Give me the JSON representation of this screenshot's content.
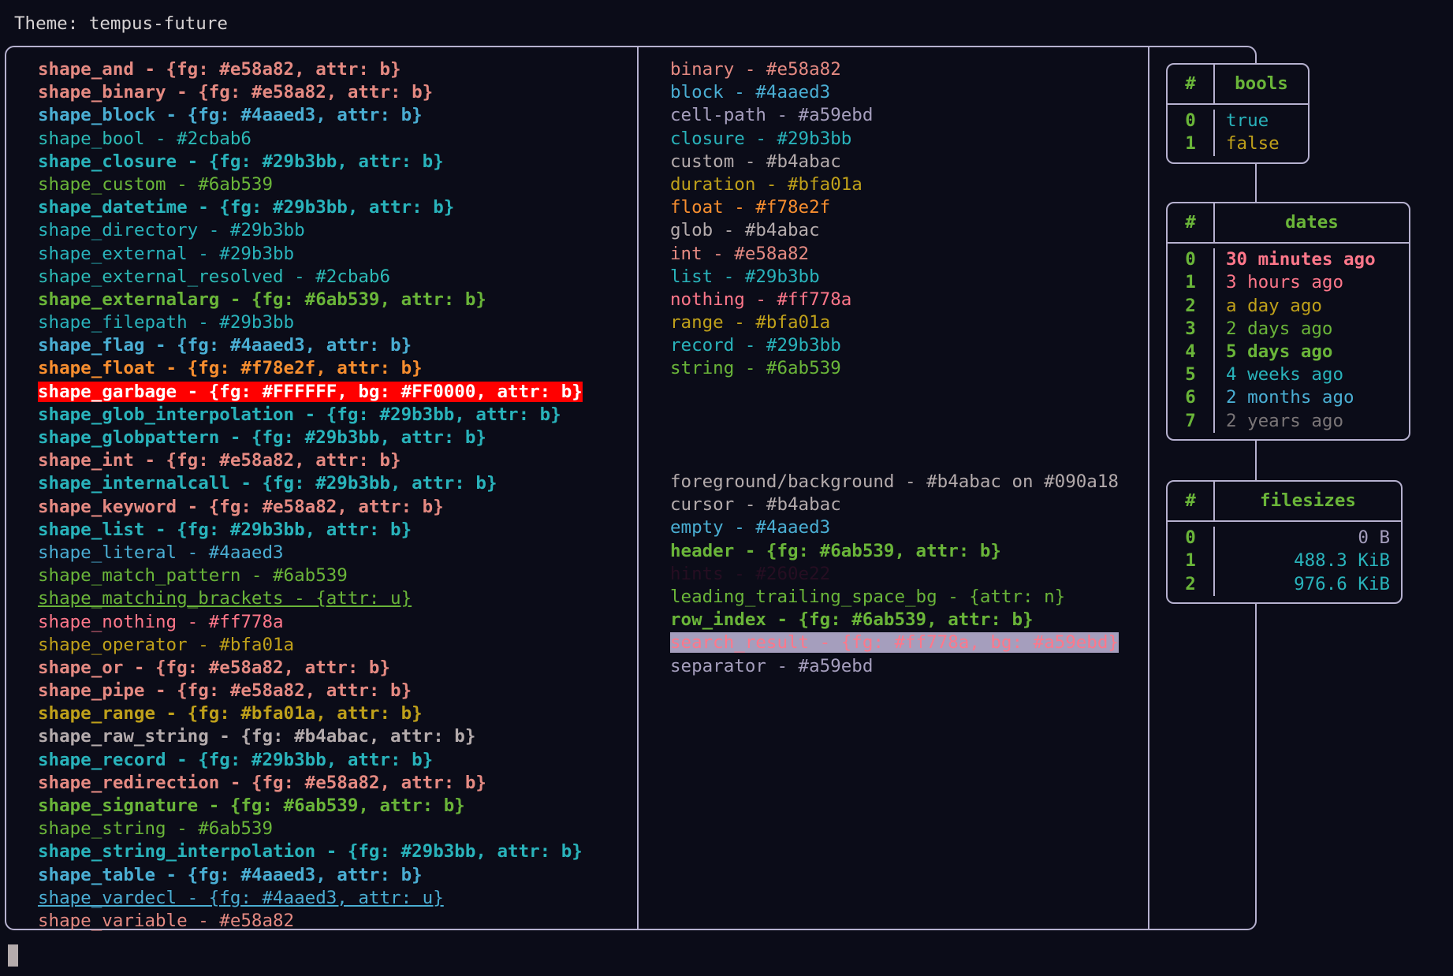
{
  "header": {
    "theme_label": "Theme: tempus-future"
  },
  "colors": {
    "background": "#0b0c18",
    "foreground": "#b4abac",
    "border": "#b6b1cf",
    "red": "#e58a82",
    "cyan": "#29b3bb",
    "light_blue": "#4aaed3",
    "teal": "#2cbab6",
    "green": "#6ab539",
    "orange": "#f78e2f",
    "yellow": "#bfa01a",
    "pink": "#ff778a",
    "purple": "#a59ebd",
    "garbage_fg": "#FFFFFF",
    "garbage_bg": "#FF0000",
    "hints": "#260e22",
    "search_result_bg": "#a59ebd"
  },
  "shapes_column": [
    {
      "text": "shape_and - {fg: #e58a82, attr: b}",
      "fg": "#e58a82",
      "bold": true
    },
    {
      "text": "shape_binary - {fg: #e58a82, attr: b}",
      "fg": "#e58a82",
      "bold": true
    },
    {
      "text": "shape_block - {fg: #4aaed3, attr: b}",
      "fg": "#4aaed3",
      "bold": true
    },
    {
      "text": "shape_bool - #2cbab6",
      "fg": "#2cbab6",
      "bold": false
    },
    {
      "text": "shape_closure - {fg: #29b3bb, attr: b}",
      "fg": "#29b3bb",
      "bold": true
    },
    {
      "text": "shape_custom - #6ab539",
      "fg": "#6ab539",
      "bold": false
    },
    {
      "text": "shape_datetime - {fg: #29b3bb, attr: b}",
      "fg": "#29b3bb",
      "bold": true
    },
    {
      "text": "shape_directory - #29b3bb",
      "fg": "#29b3bb",
      "bold": false
    },
    {
      "text": "shape_external - #29b3bb",
      "fg": "#29b3bb",
      "bold": false
    },
    {
      "text": "shape_external_resolved - #2cbab6",
      "fg": "#2cbab6",
      "bold": false
    },
    {
      "text": "shape_externalarg - {fg: #6ab539, attr: b}",
      "fg": "#6ab539",
      "bold": true
    },
    {
      "text": "shape_filepath - #29b3bb",
      "fg": "#29b3bb",
      "bold": false
    },
    {
      "text": "shape_flag - {fg: #4aaed3, attr: b}",
      "fg": "#4aaed3",
      "bold": true
    },
    {
      "text": "shape_float - {fg: #f78e2f, attr: b}",
      "fg": "#f78e2f",
      "bold": true
    },
    {
      "text": "shape_garbage - {fg: #FFFFFF, bg: #FF0000, attr: b}",
      "fg": "#FFFFFF",
      "bg": "#FF0000",
      "bold": true
    },
    {
      "text": "shape_glob_interpolation - {fg: #29b3bb, attr: b}",
      "fg": "#29b3bb",
      "bold": true
    },
    {
      "text": "shape_globpattern - {fg: #29b3bb, attr: b}",
      "fg": "#29b3bb",
      "bold": true
    },
    {
      "text": "shape_int - {fg: #e58a82, attr: b}",
      "fg": "#e58a82",
      "bold": true
    },
    {
      "text": "shape_internalcall - {fg: #29b3bb, attr: b}",
      "fg": "#29b3bb",
      "bold": true
    },
    {
      "text": "shape_keyword - {fg: #e58a82, attr: b}",
      "fg": "#e58a82",
      "bold": true
    },
    {
      "text": "shape_list - {fg: #29b3bb, attr: b}",
      "fg": "#29b3bb",
      "bold": true
    },
    {
      "text": "shape_literal - #4aaed3",
      "fg": "#4aaed3",
      "bold": false
    },
    {
      "text": "shape_match_pattern - #6ab539",
      "fg": "#6ab539",
      "bold": false
    },
    {
      "text": "shape_matching_brackets - {attr: u}",
      "fg": "#6ab539",
      "bold": false,
      "underline": true
    },
    {
      "text": "shape_nothing - #ff778a",
      "fg": "#ff778a",
      "bold": false
    },
    {
      "text": "shape_operator - #bfa01a",
      "fg": "#bfa01a",
      "bold": false
    },
    {
      "text": "shape_or - {fg: #e58a82, attr: b}",
      "fg": "#e58a82",
      "bold": true
    },
    {
      "text": "shape_pipe - {fg: #e58a82, attr: b}",
      "fg": "#e58a82",
      "bold": true
    },
    {
      "text": "shape_range - {fg: #bfa01a, attr: b}",
      "fg": "#bfa01a",
      "bold": true
    },
    {
      "text": "shape_raw_string - {fg: #b4abac, attr: b}",
      "fg": "#b4abac",
      "bold": true
    },
    {
      "text": "shape_record - {fg: #29b3bb, attr: b}",
      "fg": "#29b3bb",
      "bold": true
    },
    {
      "text": "shape_redirection - {fg: #e58a82, attr: b}",
      "fg": "#e58a82",
      "bold": true
    },
    {
      "text": "shape_signature - {fg: #6ab539, attr: b}",
      "fg": "#6ab539",
      "bold": true
    },
    {
      "text": "shape_string - #6ab539",
      "fg": "#6ab539",
      "bold": false
    },
    {
      "text": "shape_string_interpolation - {fg: #29b3bb, attr: b}",
      "fg": "#29b3bb",
      "bold": true
    },
    {
      "text": "shape_table - {fg: #4aaed3, attr: b}",
      "fg": "#4aaed3",
      "bold": true
    },
    {
      "text": "shape_vardecl - {fg: #4aaed3, attr: u}",
      "fg": "#4aaed3",
      "bold": false,
      "underline": true
    },
    {
      "text": "shape_variable - #e58a82",
      "fg": "#e58a82",
      "bold": false
    }
  ],
  "types_column": [
    {
      "text": "binary - #e58a82",
      "fg": "#e58a82",
      "bold": false
    },
    {
      "text": "block - #4aaed3",
      "fg": "#4aaed3",
      "bold": false
    },
    {
      "text": "cell-path - #a59ebd",
      "fg": "#a59ebd",
      "bold": false
    },
    {
      "text": "closure - #29b3bb",
      "fg": "#29b3bb",
      "bold": false
    },
    {
      "text": "custom - #b4abac",
      "fg": "#b4abac",
      "bold": false
    },
    {
      "text": "duration - #bfa01a",
      "fg": "#bfa01a",
      "bold": false
    },
    {
      "text": "float - #f78e2f",
      "fg": "#f78e2f",
      "bold": false
    },
    {
      "text": "glob - #b4abac",
      "fg": "#b4abac",
      "bold": false
    },
    {
      "text": "int - #e58a82",
      "fg": "#e58a82",
      "bold": false
    },
    {
      "text": "list - #29b3bb",
      "fg": "#29b3bb",
      "bold": false
    },
    {
      "text": "nothing - #ff778a",
      "fg": "#ff778a",
      "bold": false
    },
    {
      "text": "range - #bfa01a",
      "fg": "#bfa01a",
      "bold": false
    },
    {
      "text": "record - #29b3bb",
      "fg": "#29b3bb",
      "bold": false
    },
    {
      "text": "string - #6ab539",
      "fg": "#6ab539",
      "bold": false
    }
  ],
  "ui_column": [
    {
      "text": "foreground/background - #b4abac on #090a18",
      "fg": "#b4abac",
      "bold": false
    },
    {
      "text": "cursor - #b4abac",
      "fg": "#b4abac",
      "bold": false
    },
    {
      "text": "empty - #4aaed3",
      "fg": "#4aaed3",
      "bold": false
    },
    {
      "text": "header - {fg: #6ab539, attr: b}",
      "fg": "#6ab539",
      "bold": true
    },
    {
      "text": "hints - #260e22",
      "fg": "#260e22",
      "bold": false
    },
    {
      "text": "leading_trailing_space_bg - {attr: n}",
      "fg": "#6ab539",
      "bold": false
    },
    {
      "text": "row_index - {fg: #6ab539, attr: b}",
      "fg": "#6ab539",
      "bold": true
    },
    {
      "text": "search_result - {fg: #ff778a, bg: #a59ebd}",
      "fg": "#ff778a",
      "bg": "#a59ebd",
      "bold": false
    },
    {
      "text": "separator - #a59ebd",
      "fg": "#a59ebd",
      "bold": false
    }
  ],
  "tables": {
    "bools": {
      "index_header": "#",
      "value_header": "bools",
      "rows": [
        {
          "index": "0",
          "value": "true",
          "fg": "#29b3bb",
          "bold": false
        },
        {
          "index": "1",
          "value": "false",
          "fg": "#bfa01a",
          "bold": false
        }
      ]
    },
    "dates": {
      "index_header": "#",
      "value_header": "dates",
      "rows": [
        {
          "index": "0",
          "value": "30 minutes ago",
          "fg": "#ff778a",
          "bold": true
        },
        {
          "index": "1",
          "value": "3 hours ago",
          "fg": "#ff778a",
          "bold": false
        },
        {
          "index": "2",
          "value": "a day ago",
          "fg": "#bfa01a",
          "bold": false
        },
        {
          "index": "3",
          "value": "2 days ago",
          "fg": "#6ab539",
          "bold": false
        },
        {
          "index": "4",
          "value": "5 days ago",
          "fg": "#6ab539",
          "bold": true
        },
        {
          "index": "5",
          "value": "4 weeks ago",
          "fg": "#29b3bb",
          "bold": false
        },
        {
          "index": "6",
          "value": "2 months ago",
          "fg": "#4aaed3",
          "bold": false
        },
        {
          "index": "7",
          "value": "2 years ago",
          "fg": "#7a7577",
          "bold": false
        }
      ]
    },
    "filesizes": {
      "index_header": "#",
      "value_header": "filesizes",
      "rows": [
        {
          "index": "0",
          "value": "0 B",
          "fg": "#a59ebd",
          "bold": false
        },
        {
          "index": "1",
          "value": "488.3 KiB",
          "fg": "#29b3bb",
          "bold": false
        },
        {
          "index": "2",
          "value": "976.6 KiB",
          "fg": "#29b3bb",
          "bold": false
        }
      ]
    }
  }
}
